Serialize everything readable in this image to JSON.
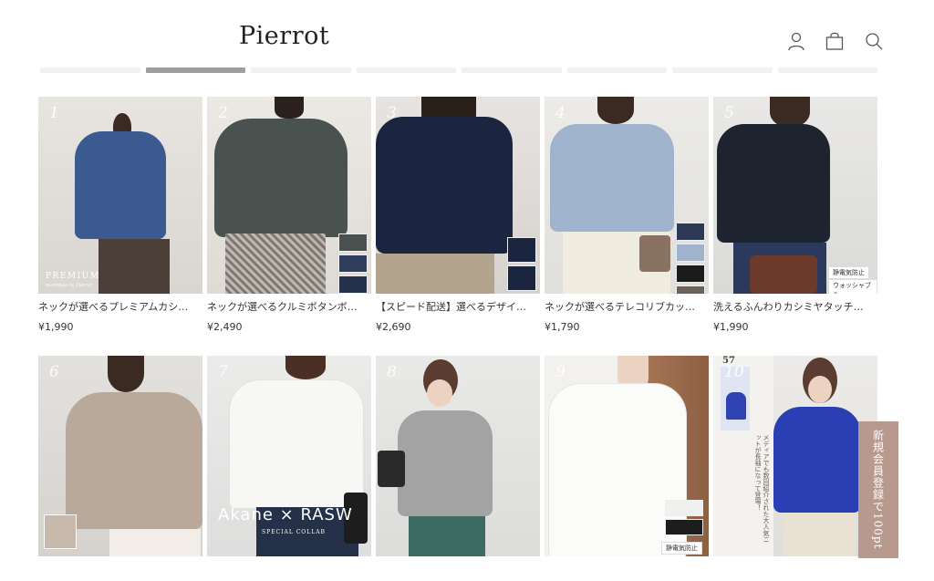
{
  "header": {
    "logo": "Pierrot",
    "icons": [
      "user-icon",
      "bag-icon",
      "search-icon"
    ]
  },
  "tabs": {
    "count": 8,
    "active_index": 1
  },
  "row1": [
    {
      "rank": "1",
      "name": "ネックが選べるプレミアムカシ…",
      "price": "¥1,990",
      "overlay_title": "PREMIUM",
      "overlay_sub": "merinbee by Pierrot"
    },
    {
      "rank": "2",
      "name": "ネックが選べるクルミボタンボ…",
      "price": "¥2,490"
    },
    {
      "rank": "3",
      "name": "【スピード配送】選べるデザイ…",
      "price": "¥2,690"
    },
    {
      "rank": "4",
      "name": "ネックが選べるテレコリブカッ…",
      "price": "¥1,790"
    },
    {
      "rank": "5",
      "name": "洗えるふんわりカシミヤタッチ…",
      "price": "¥1,990",
      "badge_1": "静電気防止",
      "badge_2": "ウォッシャブル"
    }
  ],
  "row2": [
    {
      "rank": "6"
    },
    {
      "rank": "7",
      "overlay_title": "Akane × RASW",
      "overlay_sub": "SPECIAL COLLAB"
    },
    {
      "rank": "8"
    },
    {
      "rank": "9",
      "badge_1": "静電気防止"
    },
    {
      "rank": "10",
      "overlay_jp": "メディアでも数回紹介された大人気ニットが長袖になって登場！",
      "overlay_tag": "57"
    }
  ],
  "side_banner": {
    "text": "新規会員登録で100pt"
  },
  "colors": {
    "accent_tab": "#9e9e9e",
    "banner": "#b79a8d"
  }
}
